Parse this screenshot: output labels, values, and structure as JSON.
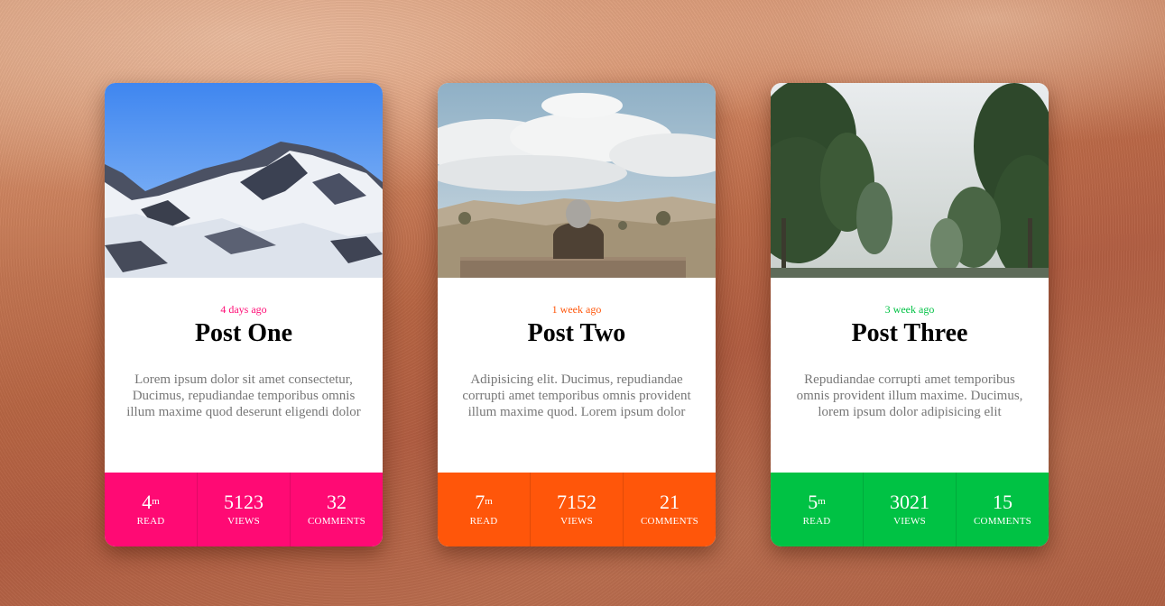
{
  "cards": [
    {
      "image": "snowy-mountain-photo",
      "date": "4 days ago",
      "title": "Post One",
      "text": "Lorem ipsum dolor sit amet consectetur, Ducimus, repudiandae temporibus omnis illum maxime quod deserunt eligendi dolor",
      "accent": "#ff0a74",
      "stats": {
        "read": {
          "value": "4",
          "unit": "m",
          "label": "READ"
        },
        "views": {
          "value": "5123",
          "label": "VIEWS"
        },
        "comments": {
          "value": "32",
          "label": "COMMENTS"
        }
      }
    },
    {
      "image": "person-on-bench-photo",
      "date": "1 week ago",
      "title": "Post Two",
      "text": "Adipisicing elit. Ducimus, repudiandae corrupti amet temporibus omnis provident illum maxime quod. Lorem ipsum dolor",
      "accent": "#ff560a",
      "stats": {
        "read": {
          "value": "7",
          "unit": "m",
          "label": "READ"
        },
        "views": {
          "value": "7152",
          "label": "VIEWS"
        },
        "comments": {
          "value": "21",
          "label": "COMMENTS"
        }
      }
    },
    {
      "image": "tree-lined-road-photo",
      "date": "3 week ago",
      "title": "Post Three",
      "text": "Repudiandae corrupti amet temporibus omnis provident illum maxime. Ducimus, lorem ipsum dolor adipisicing elit",
      "accent": "#00c244",
      "stats": {
        "read": {
          "value": "5",
          "unit": "m",
          "label": "READ"
        },
        "views": {
          "value": "3021",
          "label": "VIEWS"
        },
        "comments": {
          "value": "15",
          "label": "COMMENTS"
        }
      }
    }
  ]
}
